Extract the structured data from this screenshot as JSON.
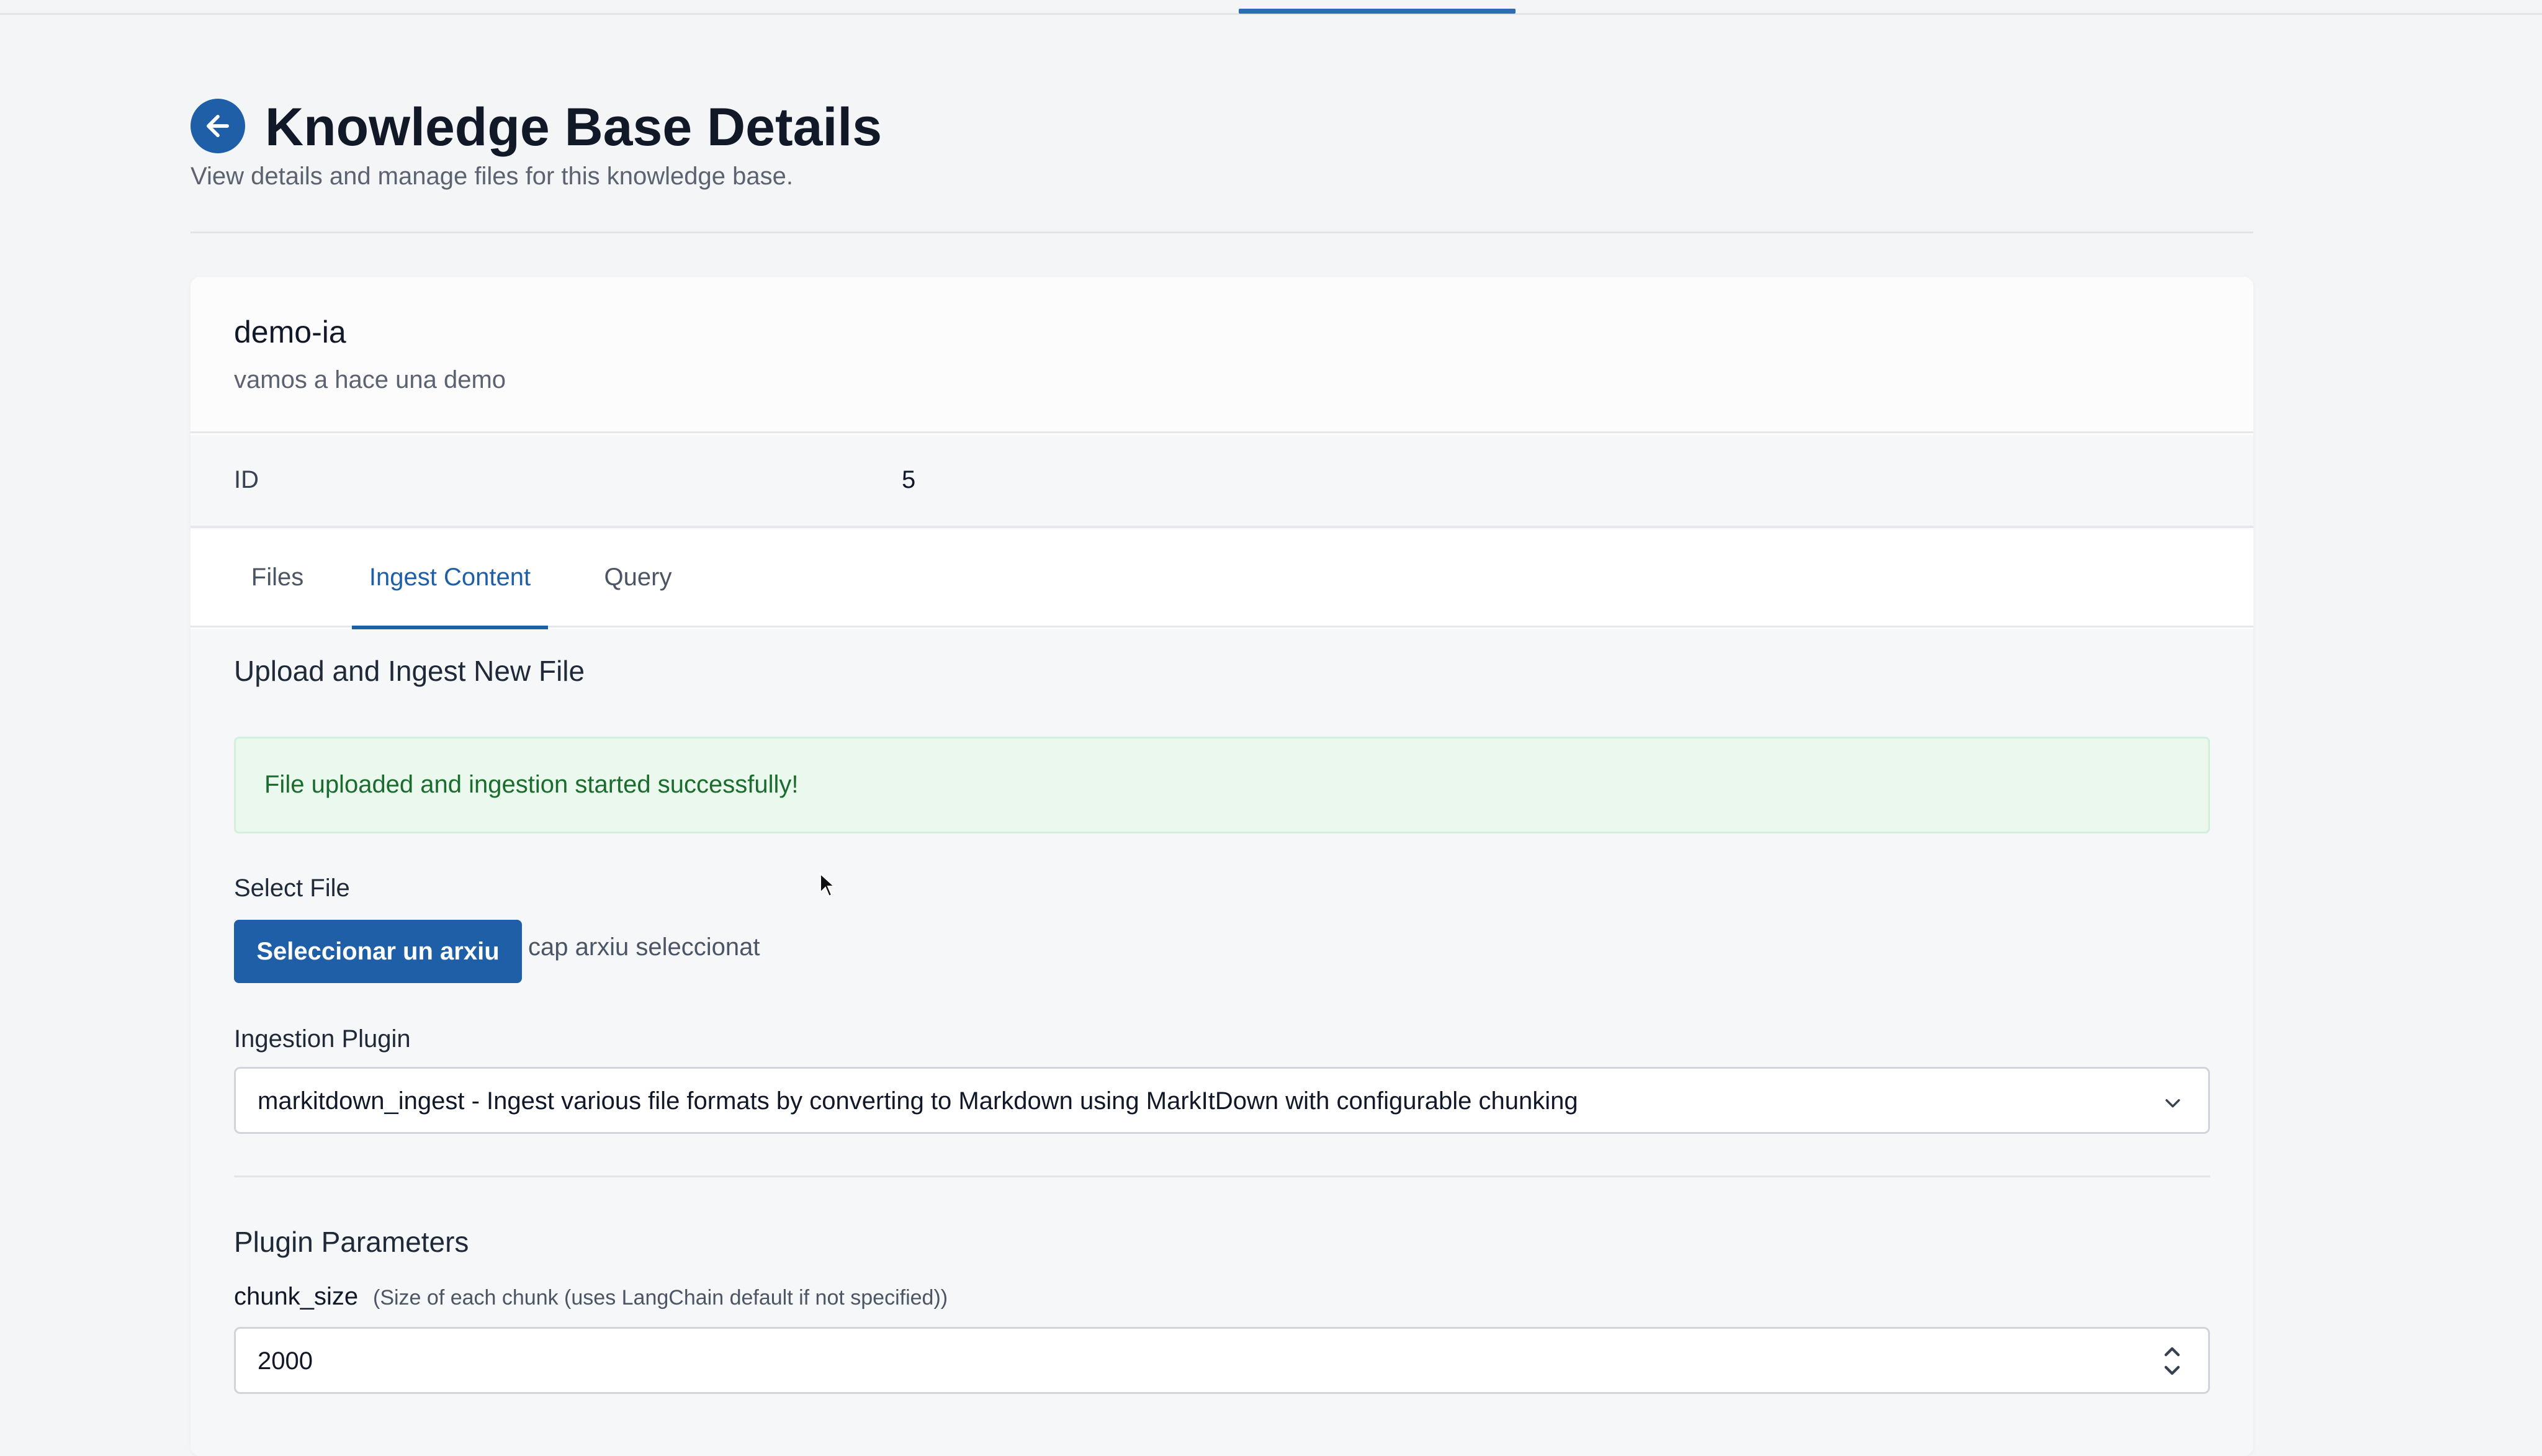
{
  "header": {
    "title": "Knowledge Base Details",
    "subtitle": "View details and manage files for this knowledge base."
  },
  "knowledge_base": {
    "name": "demo-ia",
    "description": "vamos a hace una demo",
    "id_label": "ID",
    "id_value": "5"
  },
  "tabs": [
    {
      "label": "Files",
      "active": false
    },
    {
      "label": "Ingest Content",
      "active": true
    },
    {
      "label": "Query",
      "active": false
    }
  ],
  "ingest": {
    "section_title": "Upload and Ingest New File",
    "alert": "File uploaded and ingestion started successfully!",
    "select_file_label": "Select File",
    "select_file_button": "Seleccionar un arxiu",
    "select_file_status": "cap arxiu seleccionat",
    "plugin_label": "Ingestion Plugin",
    "plugin_value": "markitdown_ingest - Ingest various file formats by converting to Markdown using MarkItDown with configurable chunking",
    "params_title": "Plugin Parameters",
    "chunk_size_label": "chunk_size",
    "chunk_size_help": "(Size of each chunk (uses LangChain default if not specified))",
    "chunk_size_value": "2000"
  },
  "colors": {
    "accent": "#1f5fa8",
    "success_bg": "#eaf8ee",
    "success_text": "#1c6b2e"
  },
  "icons": {
    "back": "arrow-left-icon",
    "select": "chevron-down-icon",
    "spinner": "stepper-arrows-icon"
  }
}
